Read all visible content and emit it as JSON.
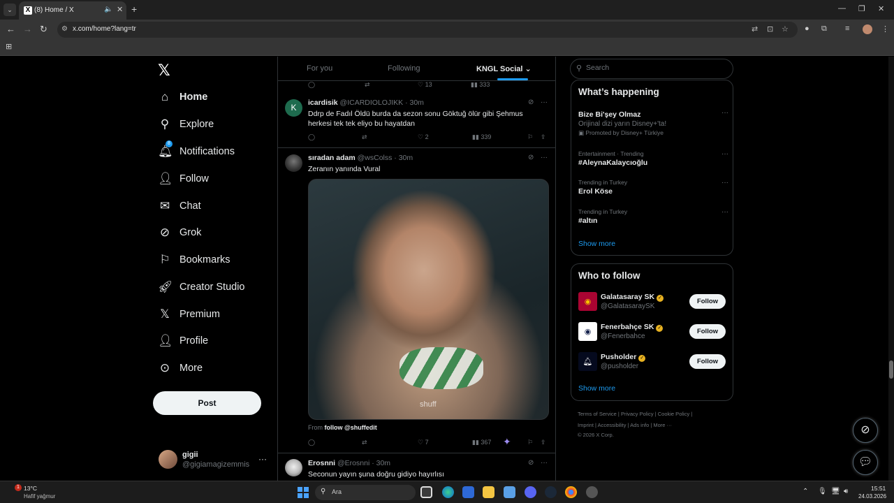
{
  "browser": {
    "tab_title": "(8) Home / X",
    "url": "x.com/home?lang=tr"
  },
  "nav": {
    "items": [
      {
        "key": "home",
        "label": "Home",
        "icon": "home-icon",
        "active": true
      },
      {
        "key": "explore",
        "label": "Explore",
        "icon": "search-icon"
      },
      {
        "key": "notifications",
        "label": "Notifications",
        "icon": "bell-icon",
        "badge": "8"
      },
      {
        "key": "follow",
        "label": "Follow",
        "icon": "add-person-icon"
      },
      {
        "key": "chat",
        "label": "Chat",
        "icon": "mail-icon"
      },
      {
        "key": "grok",
        "label": "Grok",
        "icon": "grok-icon"
      },
      {
        "key": "bookmarks",
        "label": "Bookmarks",
        "icon": "bookmark-icon"
      },
      {
        "key": "creator-studio",
        "label": "Creator Studio",
        "icon": "rocket-icon"
      },
      {
        "key": "premium",
        "label": "Premium",
        "icon": "x-icon"
      },
      {
        "key": "profile",
        "label": "Profile",
        "icon": "person-icon"
      },
      {
        "key": "more",
        "label": "More",
        "icon": "more-circle-icon"
      }
    ],
    "post_label": "Post",
    "account": {
      "name": "gigii",
      "handle": "@gigiamagizemmis"
    }
  },
  "feed": {
    "tabs": [
      "For you",
      "Following",
      "KNGL Social"
    ],
    "top_counts": {
      "likes": "13",
      "views": "333"
    },
    "tweets": [
      {
        "name": "icardisik",
        "handle": "@ICARDIOLOJIKK",
        "time": "30m",
        "avatar_letter": "K",
        "avatar_color": "#1e6b4e",
        "text": "Ddrp de Fadıl Öldü burda da sezon sonu Göktuğ ölür gibi Şehmus herkesi tek tek eliyo bu hayatdan",
        "likes": "2",
        "views": "339"
      },
      {
        "name": "sıradan adam",
        "handle": "@wsColss",
        "time": "30m",
        "text": "Zeranın yanında Vural",
        "media_watermark": "shuff",
        "credit_prefix": "From",
        "credit_link": "follow @shuffedit",
        "likes": "7",
        "views": "367"
      },
      {
        "name": "Erosnni",
        "handle": "@Erosnni",
        "time": "30m",
        "text": "Seconun yayın şuna doğru gidiyo hayırlısı"
      }
    ]
  },
  "search": {
    "placeholder": "Search"
  },
  "trends": {
    "title": "What’s happening",
    "items": [
      {
        "name": "Bize Bi'şey Olmaz",
        "subtitle": "Orijinal dizi yarın Disney+'ta!",
        "promo": "Promoted by Disney+ Türkiye"
      },
      {
        "context": "Entertainment · Trending",
        "name": "#AleynaKalaycıoğlu"
      },
      {
        "context": "Trending in Turkey",
        "name": "Erol Köse"
      },
      {
        "context": "Trending in Turkey",
        "name": "#altın"
      }
    ],
    "show_more": "Show more"
  },
  "who_to_follow": {
    "title": "Who to follow",
    "accounts": [
      {
        "name": "Galatasaray SK",
        "handle": "@GalatasaraySK",
        "button": "Follow"
      },
      {
        "name": "Fenerbahçe SK",
        "handle": "@Fenerbahce",
        "button": "Follow"
      },
      {
        "name": "Pusholder",
        "handle": "@pusholder",
        "button": "Follow"
      }
    ],
    "show_more": "Show more"
  },
  "footer": {
    "line1": "Terms of Service  |  Privacy Policy  |  Cookie Policy  |",
    "line2": "Imprint  |  Accessibility  |  Ads info  |  More ···",
    "copyright": "© 2026 X Corp."
  },
  "taskbar": {
    "weather_badge": "1",
    "temperature": "13°C",
    "weather": "Hafif yağmur",
    "search_label": "Ara",
    "time": "15:51",
    "date": "24.03.2026"
  }
}
